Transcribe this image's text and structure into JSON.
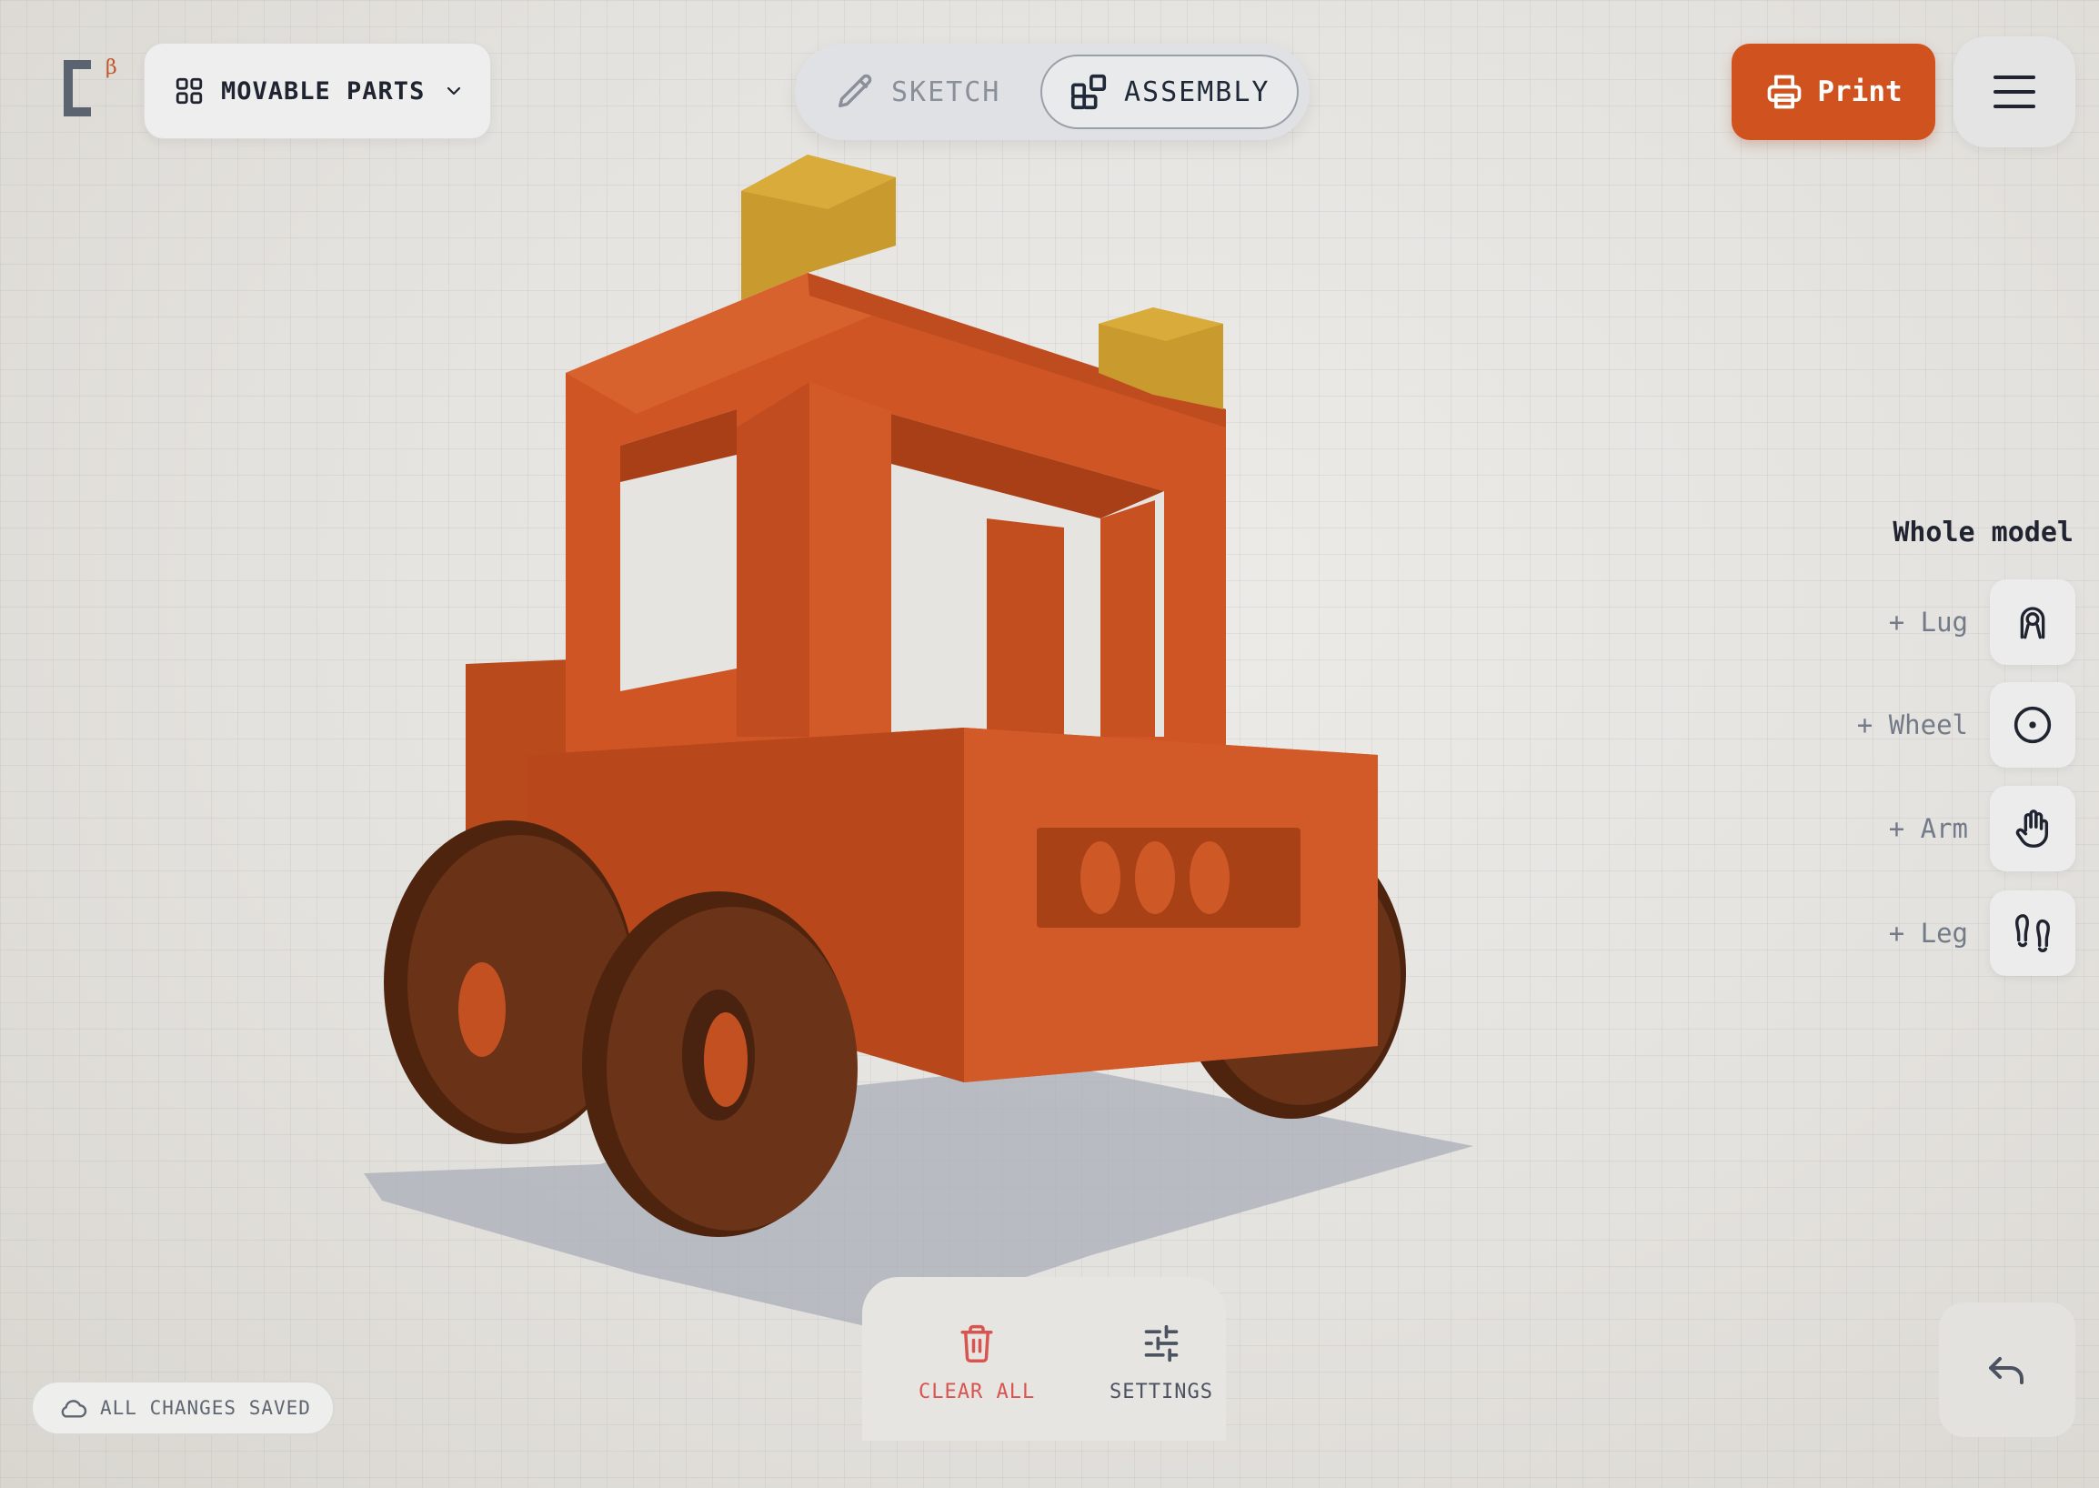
{
  "app": {
    "logo_letter": "C",
    "logo_badge": "β"
  },
  "header": {
    "parts_dropdown": {
      "label": "MOVABLE PARTS",
      "icon": "grid-icon"
    },
    "mode_toggle": {
      "sketch_label": "SKETCH",
      "assembly_label": "ASSEMBLY",
      "active": "assembly"
    },
    "print_label": "Print",
    "menu_icon": "hamburger-icon"
  },
  "right_panel": {
    "title": "Whole model",
    "parts": [
      {
        "label": "+ Lug",
        "icon": "lug-icon"
      },
      {
        "label": "+ Wheel",
        "icon": "wheel-icon"
      },
      {
        "label": "+ Arm",
        "icon": "hand-icon"
      },
      {
        "label": "+ Leg",
        "icon": "footprints-icon"
      }
    ]
  },
  "bottom_toolbar": {
    "clear_label": "CLEAR ALL",
    "settings_label": "SETTINGS"
  },
  "status": {
    "text": "ALL CHANGES SAVED",
    "icon": "cloud-icon"
  },
  "colors": {
    "accent": "#d0521f",
    "body": "#cf5524",
    "tires": "#5b2a12",
    "lugs": "#c99a2e",
    "danger": "#d9534f"
  }
}
